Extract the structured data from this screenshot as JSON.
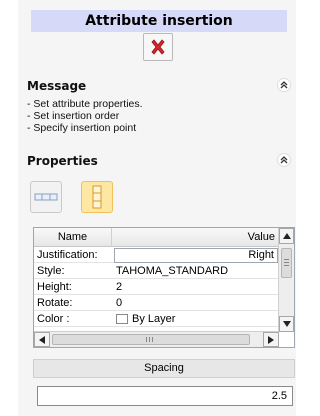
{
  "panel": {
    "title": "Attribute insertion",
    "cancel_icon": "red-x-icon"
  },
  "message": {
    "title": "Message",
    "lines": [
      "- Set attribute properties.",
      "- Set insertion order",
      "- Specify insertion point"
    ]
  },
  "properties": {
    "title": "Properties",
    "buttons": [
      {
        "name": "horizontal-order",
        "icon": "horizontal-layout-icon",
        "active": false
      },
      {
        "name": "vertical-order",
        "icon": "vertical-layout-icon",
        "active": true
      }
    ],
    "grid": {
      "col_name": "Name",
      "col_value": "Value",
      "rows": [
        {
          "name": "Justification:",
          "value": "Right"
        },
        {
          "name": "Style:",
          "value": "TAHOMA_STANDARD"
        },
        {
          "name": "Height:",
          "value": "2"
        },
        {
          "name": "Rotate:",
          "value": "0"
        },
        {
          "name": "Color :",
          "value": "By Layer"
        }
      ]
    },
    "spacing_label": "Spacing",
    "spacing_value": "2.5"
  },
  "colors": {
    "title_bg": "#d6d9f7",
    "cancel_red": "#d9262b",
    "active_button": "#fde7a3"
  }
}
